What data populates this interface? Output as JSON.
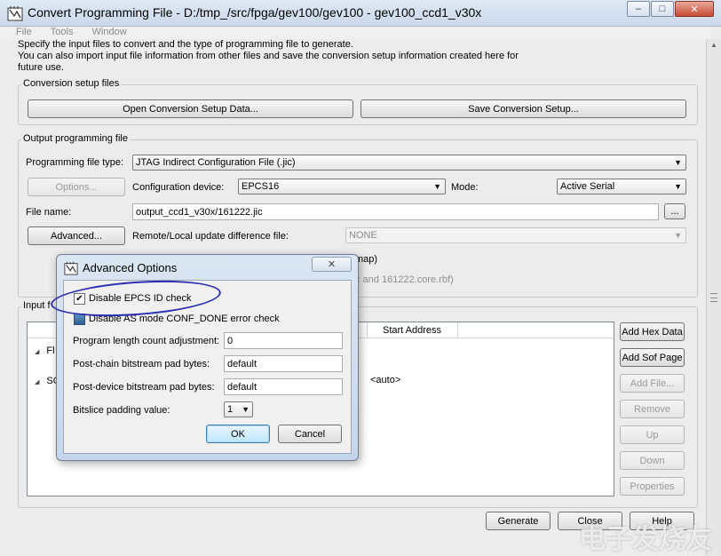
{
  "window": {
    "title": "Convert Programming File - D:/tmp_/src/fpga/gev100/gev100 - gev100_ccd1_v30x",
    "minimize": "–",
    "maximize": "□",
    "close": "✕"
  },
  "menu": [
    "File",
    "Tools",
    "Window"
  ],
  "intro": [
    "Specify the input files to convert and the type of programming file to generate.",
    "You can also import input file information from other files and save the conversion setup information created here for",
    "future use."
  ],
  "conversion_setup": {
    "title": "Conversion setup files",
    "open_button": "Open Conversion Setup Data...",
    "save_button": "Save Conversion Setup..."
  },
  "output": {
    "title": "Output programming file",
    "type_label": "Programming file type:",
    "type_value": "JTAG Indirect Configuration File (.jic)",
    "options_button": "Options...",
    "config_device_label": "Configuration device:",
    "config_device_value": "EPCS16",
    "mode_label": "Mode:",
    "mode_value": "Active Serial",
    "file_name_label": "File name:",
    "file_name_value": "output_ccd1_v30x/161222.jic",
    "browse_button": "...",
    "advanced_button": "Advanced...",
    "remote_label": "Remote/Local update difference file:",
    "remote_value": "NONE",
    "hidden_map_text": "map)",
    "hidden_files_text": "c and 161222.core.rbf)"
  },
  "input": {
    "title_fragment": "Input f",
    "start_address_header": "Start Address",
    "row1": "Fl",
    "row2": "SO",
    "row2_address": "<auto>",
    "buttons": {
      "add_hex": "Add Hex Data",
      "add_sof": "Add Sof Page",
      "add_file": "Add File...",
      "remove": "Remove",
      "up": "Up",
      "down": "Down",
      "properties": "Properties"
    }
  },
  "footer": {
    "generate": "Generate",
    "close": "Close",
    "help": "Help"
  },
  "dialog": {
    "title": "Advanced Options",
    "close_icon": "✕",
    "disable_epcs_label": "Disable EPCS ID check",
    "disable_epcs_checked": true,
    "disable_as_label": "Disable AS mode CONF_DONE error check",
    "program_length_label": "Program length count adjustment:",
    "program_length_value": "0",
    "post_chain_label": "Post-chain bitstream pad bytes:",
    "post_chain_value": "default",
    "post_device_label": "Post-device bitstream pad bytes:",
    "post_device_value": "default",
    "bitslice_label": "Bitslice padding value:",
    "bitslice_value": "1",
    "ok": "OK",
    "cancel": "Cancel"
  },
  "watermark": "电子发烧友",
  "colors": {
    "accent": "#3c7fb1",
    "annotation": "#2a2fb0"
  }
}
